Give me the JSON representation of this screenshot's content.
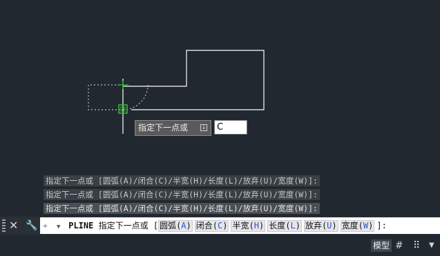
{
  "dynamic_input": {
    "prompt_label": "指定下一点或",
    "options_icon": "down-arrow-options-icon",
    "value": "C"
  },
  "history": [
    "指定下一点或 [圆弧(A)/闭合(C)/半宽(H)/长度(L)/放弃(U)/宽度(W)]:",
    "指定下一点或 [圆弧(A)/闭合(C)/半宽(H)/长度(L)/放弃(U)/宽度(W)]:",
    "指定下一点或 [圆弧(A)/闭合(C)/半宽(H)/长度(L)/放弃(U)/宽度(W)]:"
  ],
  "command_line": {
    "command": "PLINE",
    "prompt": "指定下一点或 [",
    "options": [
      {
        "label": "圆弧",
        "key": "A"
      },
      {
        "label": "闭合",
        "key": "C"
      },
      {
        "label": "半宽",
        "key": "H"
      },
      {
        "label": "长度",
        "key": "L"
      },
      {
        "label": "放弃",
        "key": "U"
      },
      {
        "label": "宽度",
        "key": "W"
      }
    ],
    "suffix": "]:"
  },
  "status": {
    "model_label": "模型"
  },
  "colors": {
    "background": "#212830",
    "geometry": "#ffffff",
    "snap_marker": "#2fbf2f",
    "tracking": "#bfbfbf"
  },
  "icons": [
    "close-icon",
    "wrench-icon",
    "grip-icon",
    "pick-cursor-icon",
    "grid-icon",
    "snap-mode-icon",
    "chevron-down-icon"
  ]
}
